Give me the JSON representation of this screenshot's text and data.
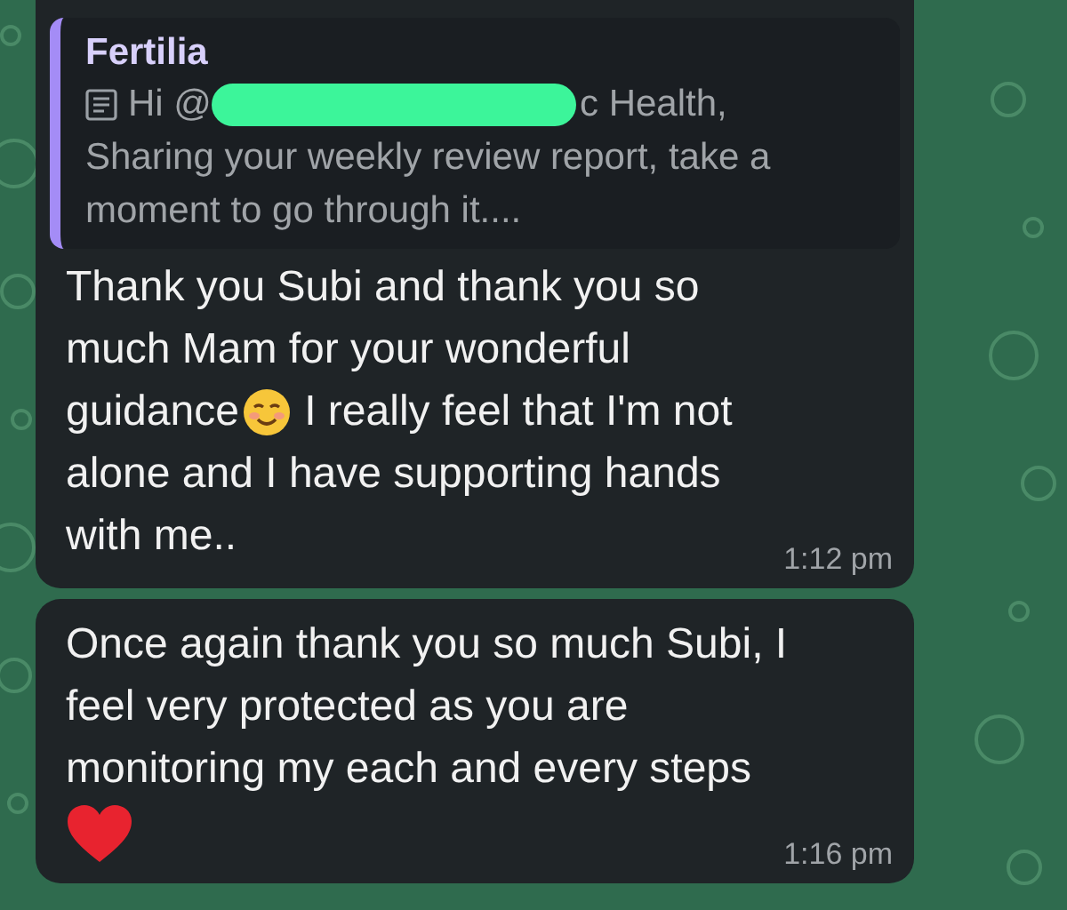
{
  "messages": [
    {
      "quote": {
        "sender": "Fertilia",
        "text_start": "Hi @",
        "redacted": true,
        "text_end": "c Health,",
        "body_lines": [
          "Sharing your weekly review report, take a",
          "moment to go through it...."
        ]
      },
      "lines": [
        [
          {
            "kind": "text",
            "text": "Thank you Subi and thank you so"
          }
        ],
        [
          {
            "kind": "text",
            "text": "much Mam for your wonderful"
          }
        ],
        [
          {
            "kind": "text",
            "text": "guidance"
          },
          {
            "kind": "emoji_smile"
          },
          {
            "kind": "text",
            "text": " I really feel that I'm not"
          }
        ],
        [
          {
            "kind": "text",
            "text": "alone and I have supporting hands"
          }
        ],
        [
          {
            "kind": "text",
            "text": "with me.."
          }
        ]
      ],
      "time": "1:12 pm"
    },
    {
      "lines": [
        [
          {
            "kind": "text",
            "text": "Once again thank you so much Subi, I"
          }
        ],
        [
          {
            "kind": "text",
            "text": "feel very protected as you are"
          }
        ],
        [
          {
            "kind": "text",
            "text": "monitoring my each and every steps"
          }
        ],
        [
          {
            "kind": "emoji_heart"
          }
        ]
      ],
      "time": "1:16 pm"
    }
  ]
}
